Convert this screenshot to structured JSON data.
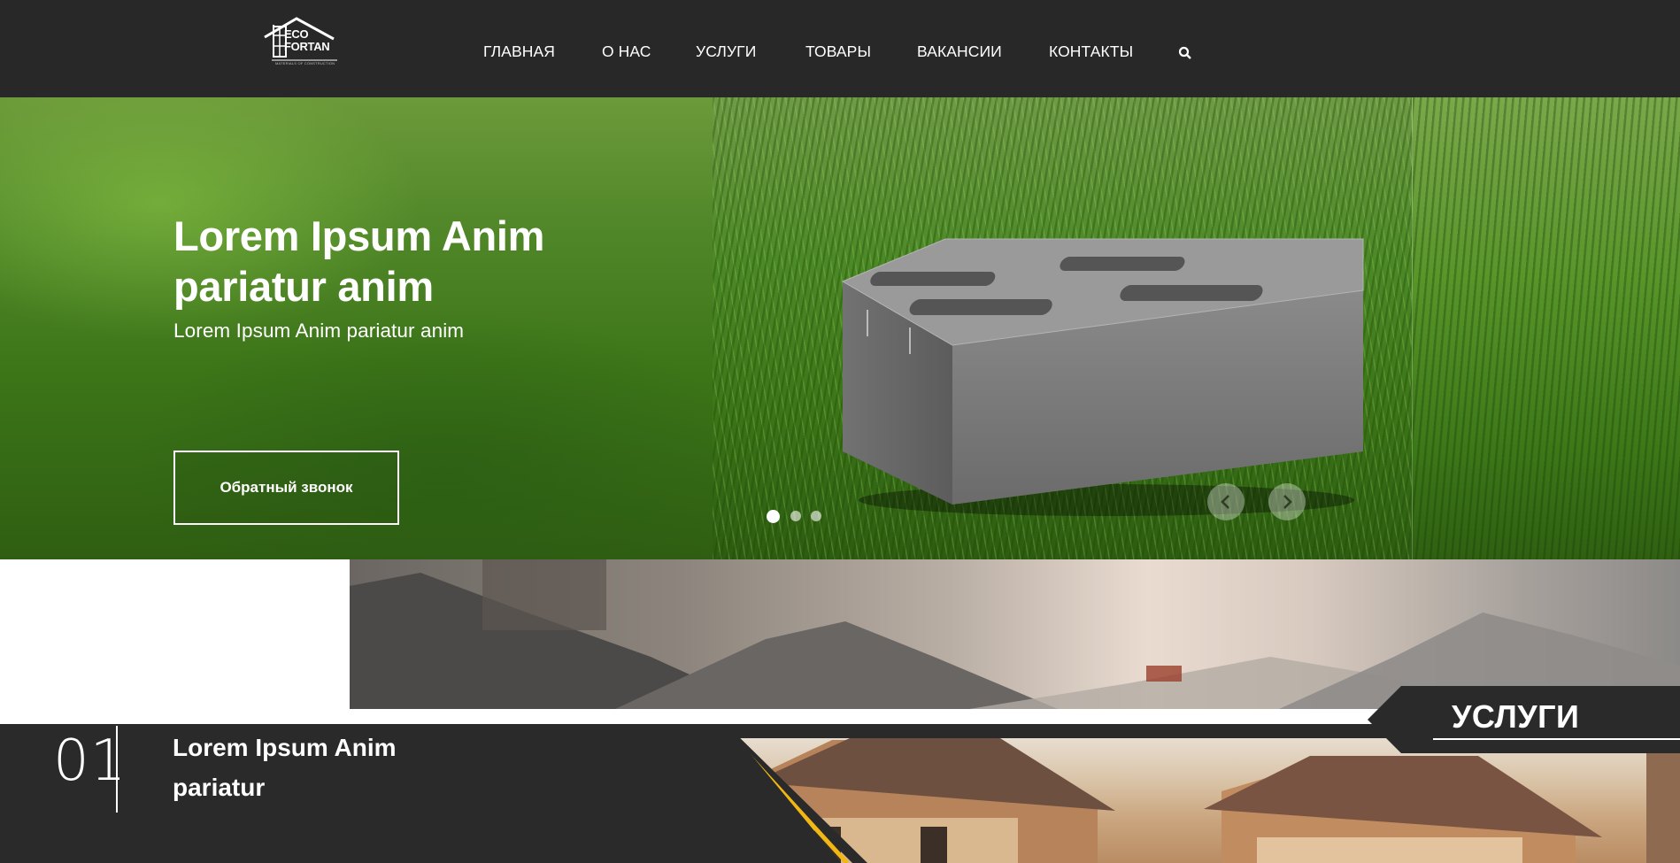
{
  "header": {
    "logo": {
      "line1": "ECO",
      "line2": "FORTAN",
      "tagline": "MATERIALS OF CONSTRUCTION"
    },
    "nav": [
      {
        "label": "ГЛАВНАЯ"
      },
      {
        "label": "О НАС"
      },
      {
        "label": "УСЛУГИ"
      },
      {
        "label": "ТОВАРЫ"
      },
      {
        "label": "ВАКАНСИИ"
      },
      {
        "label": "КОНТАКТЫ"
      }
    ],
    "search_icon": "search-icon"
  },
  "hero": {
    "title": "Lorem Ipsum Anim pariatur anim",
    "subtitle": "Lorem Ipsum Anim pariatur anim",
    "callback_button": "Обратный звонок",
    "slides": {
      "count": 3,
      "active": 1
    },
    "prev_icon": "chevron-left-icon",
    "next_icon": "chevron-right-icon"
  },
  "services": {
    "label": "УСЛУГИ",
    "item": {
      "number": "01",
      "title": "Lorem Ipsum Anim pariatur"
    },
    "accent_color": "#f2b713",
    "dark_color": "#2a2a2a"
  }
}
